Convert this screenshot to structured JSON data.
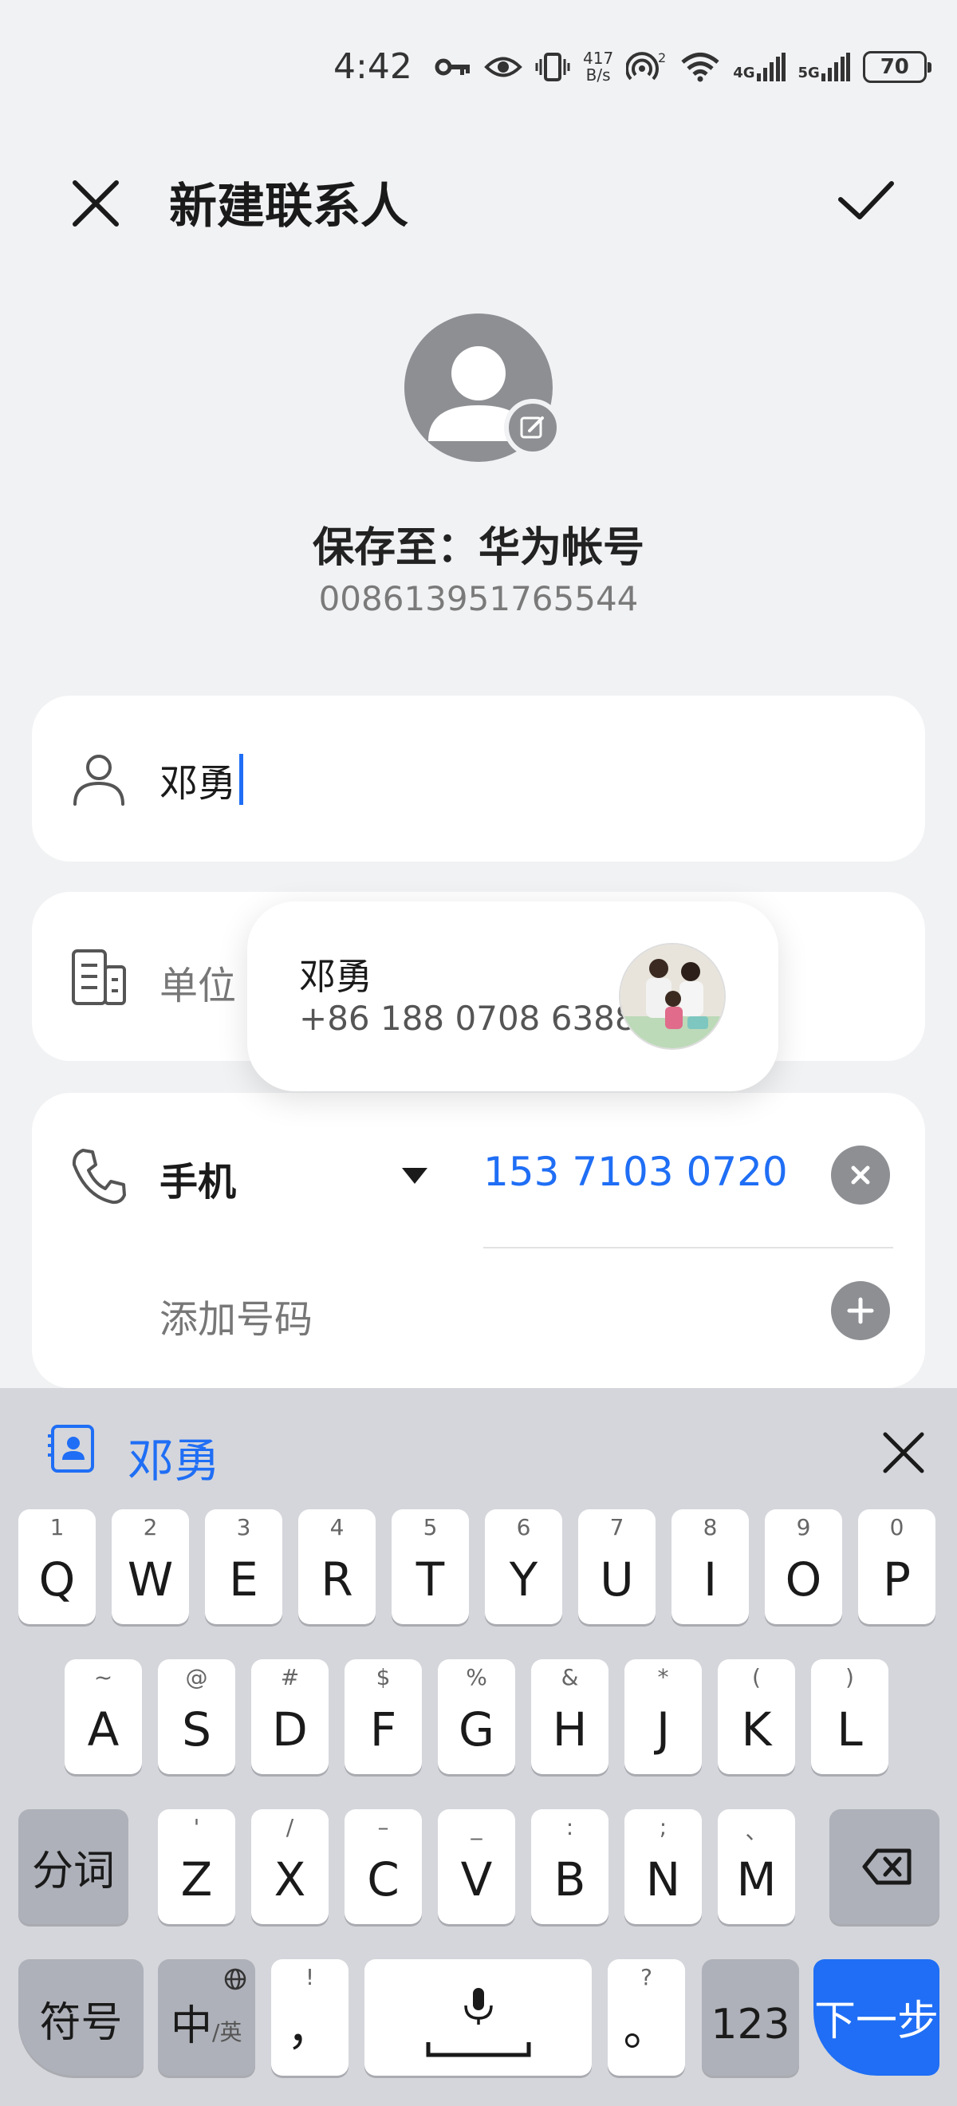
{
  "status_bar": {
    "time": "4:42",
    "speed_top": "417",
    "speed_bottom": "B/s",
    "hotspot_badge": "2",
    "net1": "4G",
    "net2": "5G",
    "battery": "70"
  },
  "header": {
    "title": "新建联系人"
  },
  "account": {
    "save_to": "保存至：华为帐号",
    "number": "008613951765544"
  },
  "form": {
    "name_value": "邓勇",
    "org_placeholder": "单位",
    "phone_type": "手机",
    "phone_number": "153 7103 0720",
    "add_number": "添加号码"
  },
  "suggestion": {
    "name": "邓勇",
    "number": "+86 188 0708 6388"
  },
  "keyboard": {
    "candidate": "邓勇",
    "row1": [
      {
        "main": "Q",
        "sub": "1"
      },
      {
        "main": "W",
        "sub": "2"
      },
      {
        "main": "E",
        "sub": "3"
      },
      {
        "main": "R",
        "sub": "4"
      },
      {
        "main": "T",
        "sub": "5"
      },
      {
        "main": "Y",
        "sub": "6"
      },
      {
        "main": "U",
        "sub": "7"
      },
      {
        "main": "I",
        "sub": "8"
      },
      {
        "main": "O",
        "sub": "9"
      },
      {
        "main": "P",
        "sub": "0"
      }
    ],
    "row2": [
      {
        "main": "A",
        "sub": "~"
      },
      {
        "main": "S",
        "sub": "@"
      },
      {
        "main": "D",
        "sub": "#"
      },
      {
        "main": "F",
        "sub": "$"
      },
      {
        "main": "G",
        "sub": "%"
      },
      {
        "main": "H",
        "sub": "&"
      },
      {
        "main": "J",
        "sub": "*"
      },
      {
        "main": "K",
        "sub": "("
      },
      {
        "main": "L",
        "sub": ")"
      }
    ],
    "row3": [
      {
        "main": "Z",
        "sub": "'"
      },
      {
        "main": "X",
        "sub": "/"
      },
      {
        "main": "C",
        "sub": "–"
      },
      {
        "main": "V",
        "sub": "_"
      },
      {
        "main": "B",
        "sub": ":"
      },
      {
        "main": "N",
        "sub": ";"
      },
      {
        "main": "M",
        "sub": "、"
      }
    ],
    "fenci": "分词",
    "symbols": "符号",
    "lang_main": "中",
    "lang_sub": "/英",
    "comma": "，",
    "comma_sub": "!",
    "period": "。",
    "period_sub": "?",
    "numbers": "123",
    "next": "下一步"
  }
}
